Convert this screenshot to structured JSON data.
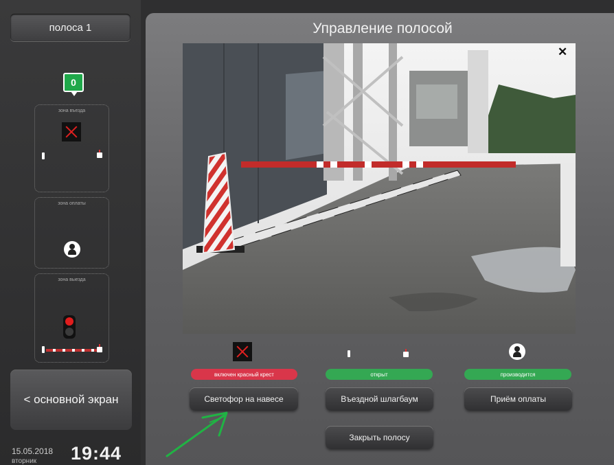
{
  "lane": {
    "label": "полоса 1"
  },
  "counter": {
    "value": "0"
  },
  "zones": {
    "entry": "зона въезда",
    "payment": "зона оплаты",
    "exit": "зона выезда"
  },
  "home_button": {
    "label": "< основной экран"
  },
  "datetime": {
    "date": "15.05.2018",
    "weekday": "вторник",
    "time": "19:44"
  },
  "panel": {
    "title": "Управление полосой"
  },
  "statuses": {
    "light": "включен красный крест",
    "barrier": "открыт",
    "payment": "производится"
  },
  "actions": {
    "light_button": "Светофор на навесе",
    "barrier_button": "Въездной шлагбаум",
    "payment_button": "Приём оплаты",
    "close_lane_button": "Закрыть полосу"
  },
  "icons": [
    "x-signal-icon",
    "barrier-icon",
    "person-icon",
    "traffic-light-icon",
    "close-icon",
    "arrow-annotation"
  ],
  "colors": {
    "red_status": "#d9364a",
    "green_status": "#34a853",
    "counter": "#1fa84a"
  }
}
